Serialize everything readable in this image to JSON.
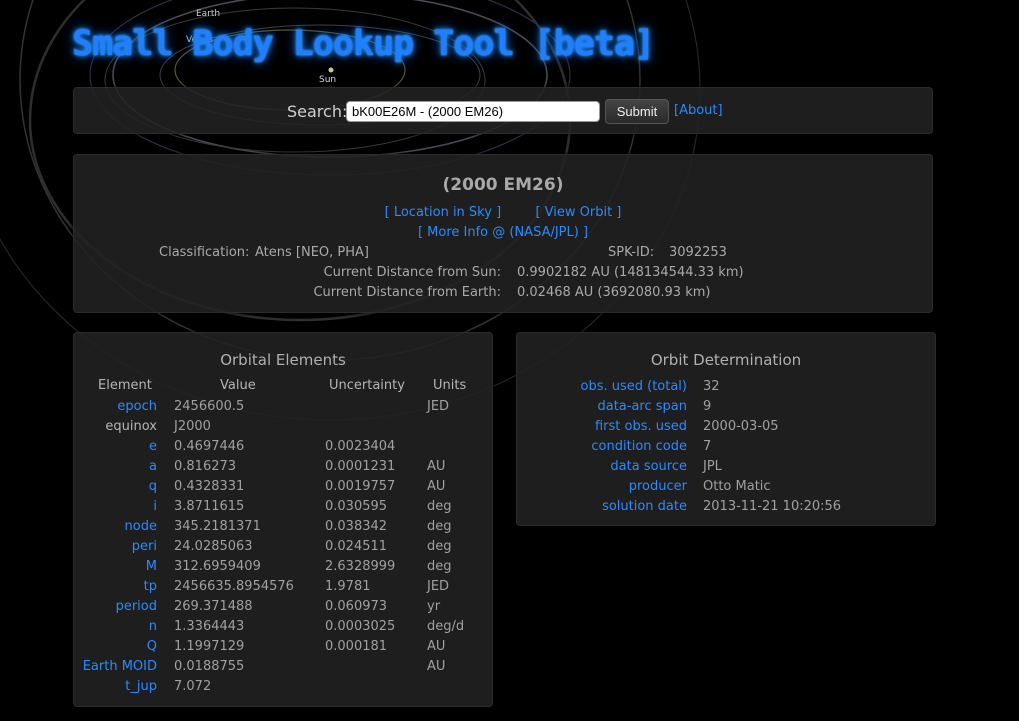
{
  "page_title": "Small Body Lookup Tool [beta]",
  "orbit_labels": [
    "Earth",
    "Venus",
    "Sun"
  ],
  "search": {
    "label": "Search:",
    "value": "bK00E26M - (2000 EM26)",
    "submit_label": "Submit",
    "about_label": "[About]"
  },
  "summary": {
    "object_name": "(2000 EM26)",
    "links": {
      "location_in_sky": "[ Location in Sky ]",
      "view_orbit": "[ View Orbit ]",
      "more_info": "[ More Info @ (NASA/JPL) ]"
    },
    "classification_label": "Classification:",
    "classification_value": "Atens [NEO, PHA]",
    "spk_label": "SPK-ID:",
    "spk_value": "3092253",
    "dist_sun_label": "Current Distance from Sun:",
    "dist_sun_value": "0.9902182 AU (148134544.33 km)",
    "dist_earth_label": "Current Distance from Earth:",
    "dist_earth_value": "0.02468 AU (3692080.93 km)"
  },
  "orbital_elements": {
    "title": "Orbital Elements",
    "headers": {
      "element": "Element",
      "value": "Value",
      "uncertainty": "Uncertainty",
      "units": "Units"
    },
    "rows": [
      {
        "name": "epoch",
        "value": "2456600.5",
        "uncertainty": "",
        "units": "JED"
      },
      {
        "name": "equinox",
        "value": "J2000",
        "uncertainty": "",
        "units": ""
      },
      {
        "name": "e",
        "value": "0.4697446",
        "uncertainty": "0.0023404",
        "units": ""
      },
      {
        "name": "a",
        "value": "0.816273",
        "uncertainty": "0.0001231",
        "units": "AU"
      },
      {
        "name": "q",
        "value": "0.4328331",
        "uncertainty": "0.0019757",
        "units": "AU"
      },
      {
        "name": "i",
        "value": "3.8711615",
        "uncertainty": "0.030595",
        "units": "deg"
      },
      {
        "name": "node",
        "value": "345.2181371",
        "uncertainty": "0.038342",
        "units": "deg"
      },
      {
        "name": "peri",
        "value": "24.0285063",
        "uncertainty": "0.024511",
        "units": "deg"
      },
      {
        "name": "M",
        "value": "312.6959409",
        "uncertainty": "2.6328999",
        "units": "deg"
      },
      {
        "name": "tp",
        "value": "2456635.8954576",
        "uncertainty": "1.9781",
        "units": "JED"
      },
      {
        "name": "period",
        "value": "269.371488",
        "uncertainty": "0.060973",
        "units": "yr"
      },
      {
        "name": "n",
        "value": "1.3364443",
        "uncertainty": "0.0003025",
        "units": "deg/d"
      },
      {
        "name": "Q",
        "value": "1.1997129",
        "uncertainty": "0.000181",
        "units": "AU"
      },
      {
        "name": "Earth MOID",
        "value": "0.0188755",
        "uncertainty": "",
        "units": "AU"
      },
      {
        "name": "t_jup",
        "value": "7.072",
        "uncertainty": "",
        "units": ""
      }
    ]
  },
  "orbit_determination": {
    "title": "Orbit Determination",
    "rows": [
      {
        "name": "obs. used (total)",
        "value": "32"
      },
      {
        "name": "data-arc span",
        "value": "9"
      },
      {
        "name": "first obs. used",
        "value": "2000-03-05"
      },
      {
        "name": "condition code",
        "value": "7"
      },
      {
        "name": "data source",
        "value": "JPL"
      },
      {
        "name": "producer",
        "value": "Otto Matic"
      },
      {
        "name": "solution date",
        "value": "2013-11-21 10:20:56"
      }
    ]
  },
  "colors": {
    "background": "#000000",
    "link": "#2a8bff",
    "title_glow": "#1e90ff",
    "panel": "#222222"
  }
}
